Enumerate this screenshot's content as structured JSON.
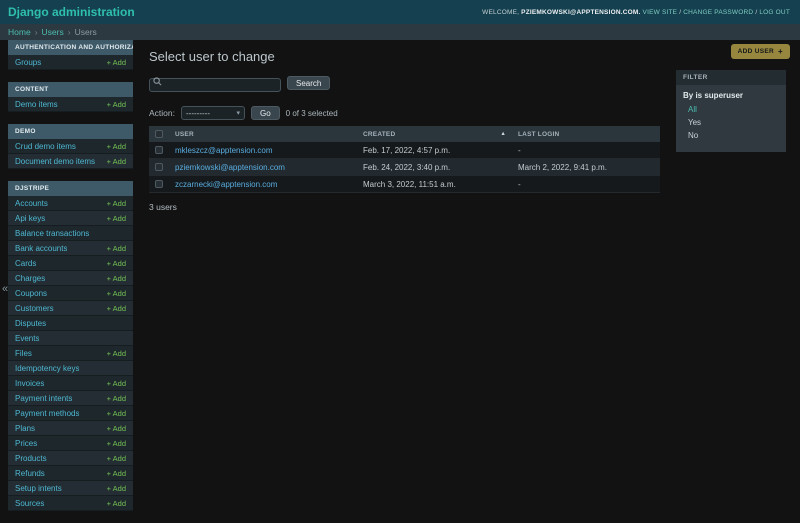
{
  "header": {
    "title": "Django administration",
    "welcome_prefix": "WELCOME,",
    "username": "PZIEMKOWSKI@APPTENSION.COM.",
    "links": [
      "VIEW SITE",
      "CHANGE PASSWORD",
      "LOG OUT"
    ],
    "link_separator": "/"
  },
  "breadcrumbs": {
    "separator": "›",
    "items": [
      {
        "label": "Home",
        "link": true
      },
      {
        "label": "Users",
        "link": true
      },
      {
        "label": "Users",
        "link": false
      }
    ]
  },
  "sidebar": {
    "toggle_icon": "«",
    "add_label": "Add",
    "add_icon": "+",
    "sections": [
      {
        "title": "AUTHENTICATION AND AUTHORIZATION",
        "items": [
          {
            "label": "Groups",
            "add": true
          }
        ]
      },
      {
        "title": "CONTENT",
        "items": [
          {
            "label": "Demo items",
            "add": true
          }
        ]
      },
      {
        "title": "DEMO",
        "items": [
          {
            "label": "Crud demo items",
            "add": true
          },
          {
            "label": "Document demo items",
            "add": true
          }
        ]
      },
      {
        "title": "DJSTRIPE",
        "items": [
          {
            "label": "Accounts",
            "add": true
          },
          {
            "label": "Api keys",
            "add": true
          },
          {
            "label": "Balance transactions",
            "add": false
          },
          {
            "label": "Bank accounts",
            "add": true
          },
          {
            "label": "Cards",
            "add": true
          },
          {
            "label": "Charges",
            "add": true
          },
          {
            "label": "Coupons",
            "add": true
          },
          {
            "label": "Customers",
            "add": true
          },
          {
            "label": "Disputes",
            "add": false
          },
          {
            "label": "Events",
            "add": false
          },
          {
            "label": "Files",
            "add": true
          },
          {
            "label": "Idempotency keys",
            "add": false
          },
          {
            "label": "Invoices",
            "add": true
          },
          {
            "label": "Payment intents",
            "add": true
          },
          {
            "label": "Payment methods",
            "add": true
          },
          {
            "label": "Plans",
            "add": true
          },
          {
            "label": "Prices",
            "add": true
          },
          {
            "label": "Products",
            "add": true
          },
          {
            "label": "Refunds",
            "add": true
          },
          {
            "label": "Setup intents",
            "add": true
          },
          {
            "label": "Sources",
            "add": true
          }
        ]
      }
    ]
  },
  "main": {
    "title": "Select user to change",
    "add_button": {
      "label": "ADD USER",
      "icon": "+"
    },
    "search": {
      "value": "",
      "button": "Search"
    },
    "actions": {
      "label": "Action:",
      "selected_option": "---------",
      "chevron": "▾",
      "go_button": "Go",
      "selection_status": "0 of 3 selected"
    },
    "table": {
      "columns": [
        "USER",
        "CREATED",
        "LAST LOGIN"
      ],
      "sort_icon": "▲",
      "rows": [
        {
          "user": "mkleszcz@apptension.com",
          "created": "Feb. 17, 2022, 4:57 p.m.",
          "last_login": "-"
        },
        {
          "user": "pziemkowski@apptension.com",
          "created": "Feb. 24, 2022, 3:40 p.m.",
          "last_login": "March 2, 2022, 9:41 p.m."
        },
        {
          "user": "zczarnecki@apptension.com",
          "created": "March 3, 2022, 11:51 a.m.",
          "last_login": "-"
        }
      ]
    },
    "summary": "3 users"
  },
  "filter": {
    "title": "FILTER",
    "groups": [
      {
        "label": "By is superuser",
        "options": [
          {
            "label": "All",
            "selected": true
          },
          {
            "label": "Yes",
            "selected": false
          },
          {
            "label": "No",
            "selected": false
          }
        ]
      }
    ]
  },
  "colors": {
    "header_bg": "#15404f",
    "accent_teal": "#2fbfae",
    "sidebar_link_blue": "#4fb8d3",
    "add_green": "#74c054",
    "table_link_blue": "#58ade0",
    "add_button_gold": "#96863e",
    "page_bg": "#121212"
  }
}
